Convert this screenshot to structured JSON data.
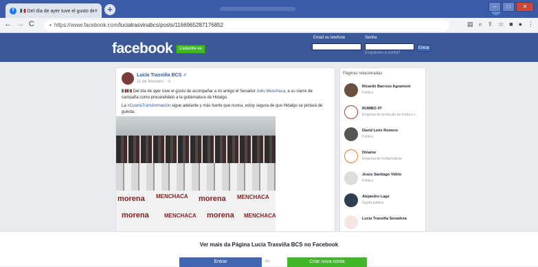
{
  "browser": {
    "tab_title": "🇲🇽 Del día de ayer tuve el gusto de",
    "url_host": "https://www.facebook.com",
    "url_path": "/luciatrasvinabcs/posts/1166965287176852",
    "new_tab": "+",
    "close_tab": "×",
    "back": "←",
    "forward": "→",
    "reload": "C",
    "lock": "🔒"
  },
  "header": {
    "logo": "facebook",
    "signup_button": "Cadastre-se",
    "email_label": "Email ou telefone",
    "password_label": "Senha",
    "forgot_link": "Esqueceu a conta?",
    "login_button": "Entrar"
  },
  "post": {
    "author": "Lucía Trasviña BCS",
    "verified": "✓",
    "date": "11 de fevereiro · ⊙",
    "p1_a": "🇲🇽🇲🇽 Del día de ayer tuve el gusto de acompañar a mi amigo el Senador",
    "p1_link": "Julio Menchaca",
    "p1_b": ", a su cierre de campaña como precandidato a la gubernatura de Hidalgo.",
    "p2_a": "La",
    "p2_link": "#CuartaTransformación",
    "p2_b": "sigue adelante y más fuerte que nunca, estoy segura de que Hidalgo se pintará de guinda.",
    "banner_word_1": "morena",
    "banner_word_2": "MENCHACA"
  },
  "sidebar": {
    "title": "Páginas relacionadas",
    "items": [
      {
        "name": "Ricardo Barroso Agramont",
        "sub": "Político"
      },
      {
        "name": "RUMBO 4T",
        "sub": "Empresa de produção de mídia e t..."
      },
      {
        "name": "David León Romero",
        "sub": "Político"
      },
      {
        "name": "Dinamo",
        "sub": "Empresa de mídia/noticiar"
      },
      {
        "name": "Jesús Santiago Vidrio",
        "sub": "Político"
      },
      {
        "name": "Alejandro Lage",
        "sub": "Figura pública"
      },
      {
        "name": "Lucía Trasviña Senadora",
        "sub": ""
      }
    ]
  },
  "overlay": {
    "text": "Ver mais da Página Lucía Trasviña BCS no Facebook",
    "login": "Entrar",
    "or": "ou",
    "create": "Criar nova conta"
  }
}
